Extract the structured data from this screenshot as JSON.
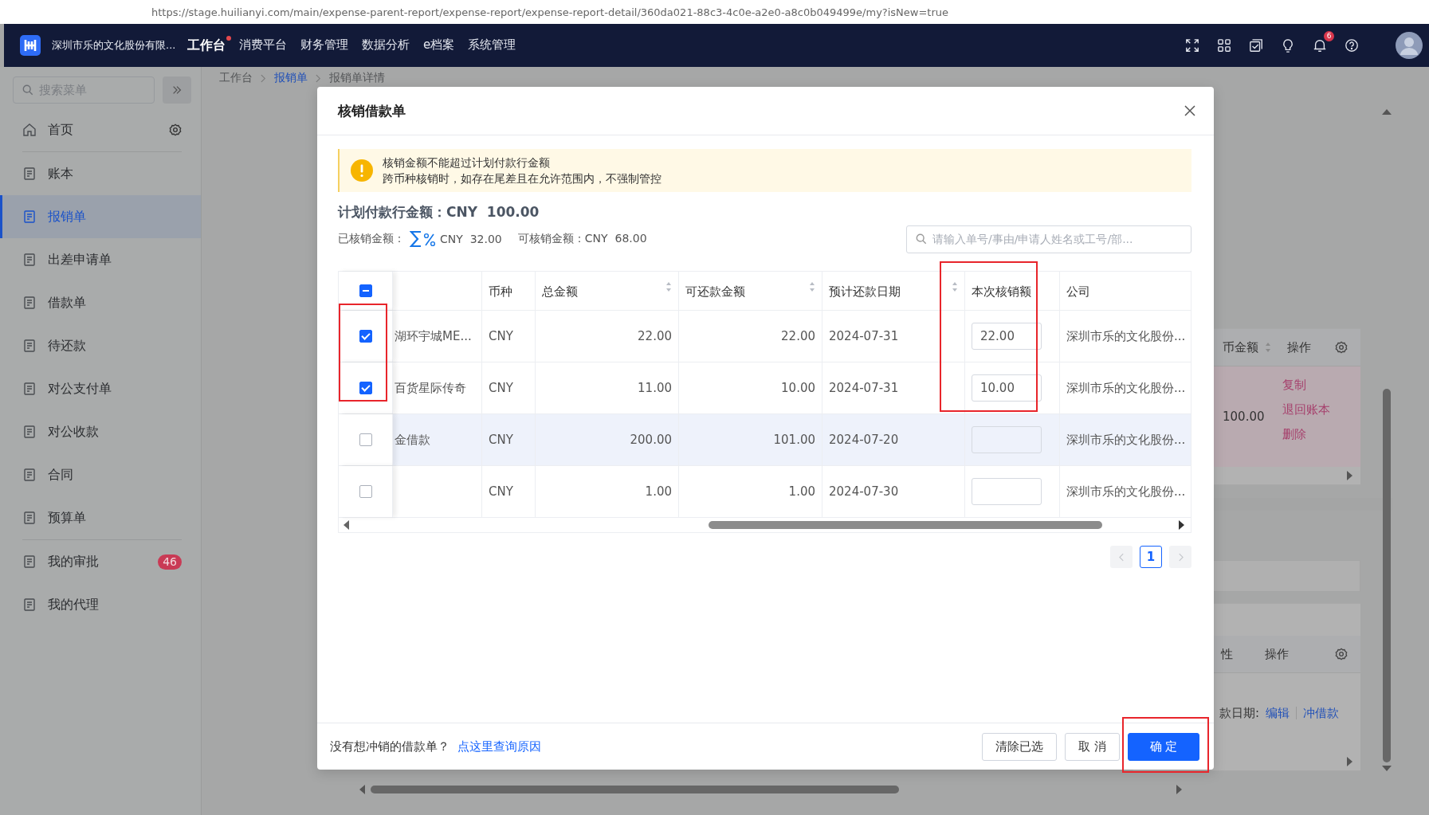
{
  "browser": {
    "url": "https://stage.huilianyi.com/main/expense-parent-report/expense-report/expense-report-detail/360da021-88c3-4c0e-a2e0-a8c0b049499e/my?isNew=true"
  },
  "topbar": {
    "company": "深圳市乐的文化股份有限...",
    "notification_count": "6",
    "nav": [
      {
        "label": "工作台",
        "selected": true,
        "dot": true
      },
      {
        "label": "消费平台",
        "selected": false,
        "dot": false
      },
      {
        "label": "财务管理",
        "selected": false,
        "dot": false
      },
      {
        "label": "数据分析",
        "selected": false,
        "dot": false
      },
      {
        "label": "e档案",
        "selected": false,
        "dot": false
      },
      {
        "label": "系统管理",
        "selected": false,
        "dot": false
      }
    ]
  },
  "sidebar": {
    "search": {
      "placeholder": "搜索菜单"
    },
    "items": [
      {
        "label": "首页",
        "selected": false,
        "divider_after": true
      },
      {
        "label": "账本",
        "selected": false,
        "divider_after": false
      },
      {
        "label": "报销单",
        "selected": true,
        "divider_after": false
      },
      {
        "label": "出差申请单",
        "selected": false,
        "divider_after": false
      },
      {
        "label": "借款单",
        "selected": false,
        "divider_after": false
      },
      {
        "label": "待还款",
        "selected": false,
        "divider_after": false
      },
      {
        "label": "对公支付单",
        "selected": false,
        "divider_after": false
      },
      {
        "label": "对公收款",
        "selected": false,
        "divider_after": false
      },
      {
        "label": "合同",
        "selected": false,
        "divider_after": false
      },
      {
        "label": "预算单",
        "selected": false,
        "divider_after": true
      },
      {
        "label": "我的审批",
        "selected": false,
        "divider_after": false,
        "badge": "46"
      },
      {
        "label": "我的代理",
        "selected": false,
        "divider_after": false
      }
    ]
  },
  "breadcrumb": [
    {
      "label": "工作台",
      "link": false
    },
    {
      "label": "报销单",
      "link": true
    },
    {
      "label": "报销单详情",
      "link": false
    }
  ],
  "background": {
    "card_1": {
      "columns": [
        "币金额",
        "操作"
      ],
      "amount": "100.00",
      "actions": [
        "复制",
        "退回账本",
        "删除"
      ]
    },
    "card_2": {
      "columns": [
        "性",
        "操作"
      ],
      "label": "款日期:",
      "actions": [
        "编辑",
        "冲借款"
      ]
    }
  },
  "dialog": {
    "title": "核销借款单",
    "alert": {
      "lines": [
        "核销金额不能超过计划付款行金额",
        "跨币种核销时，如存在尾差且在允许范围内，不强制管控"
      ]
    },
    "plan_amount": {
      "label": "计划付款行金额：",
      "value": "CNY  100.00"
    },
    "written_off": {
      "label": "已核销金额：",
      "value": "CNY  32.00"
    },
    "available": {
      "label": "可核销金额：",
      "value": "CNY  68.00"
    },
    "search": {
      "placeholder": "请输入单号/事由/申请人姓名或工号/部..."
    },
    "table": {
      "indeterminate": true,
      "selection_highlighted": true,
      "columns": [
        {
          "label": "币种"
        },
        {
          "label": "总金额",
          "sortable": true
        },
        {
          "label": "可还款金额",
          "sortable": true
        },
        {
          "label": "预计还款日期",
          "sortable": true
        },
        {
          "label": "本次核销额",
          "highlighted": true
        },
        {
          "label": "公司"
        }
      ],
      "rows": [
        {
          "selected": true,
          "hovered": false,
          "column_1": "湖环宇城ME...",
          "currency": "CNY",
          "total": "22.00",
          "repayable": "22.00",
          "due_date": "2024-07-31",
          "write_off": "22.00",
          "company": "深圳市乐的文化股份..."
        },
        {
          "selected": true,
          "hovered": false,
          "column_1": "百货星际传奇",
          "currency": "CNY",
          "total": "11.00",
          "repayable": "10.00",
          "due_date": "2024-07-31",
          "write_off": "10.00",
          "company": "深圳市乐的文化股份..."
        },
        {
          "selected": false,
          "hovered": true,
          "column_1": "金借款",
          "currency": "CNY",
          "total": "200.00",
          "repayable": "101.00",
          "due_date": "2024-07-20",
          "company": "深圳市乐的文化股份..."
        },
        {
          "selected": false,
          "hovered": false,
          "currency": "CNY",
          "total": "1.00",
          "repayable": "1.00",
          "due_date": "2024-07-30",
          "company": "深圳市乐的文化股份..."
        }
      ]
    },
    "pagination": {
      "pages": [
        {
          "label": "1",
          "selected": true
        }
      ]
    },
    "footer": {
      "hint": "没有想冲销的借款单？",
      "link": "点这里查询原因",
      "buttons": [
        {
          "label": "清除已选",
          "kind": "default"
        },
        {
          "label": "取 消",
          "kind": "default"
        },
        {
          "label": "确 定",
          "kind": "primary",
          "highlighted": true
        }
      ]
    }
  }
}
